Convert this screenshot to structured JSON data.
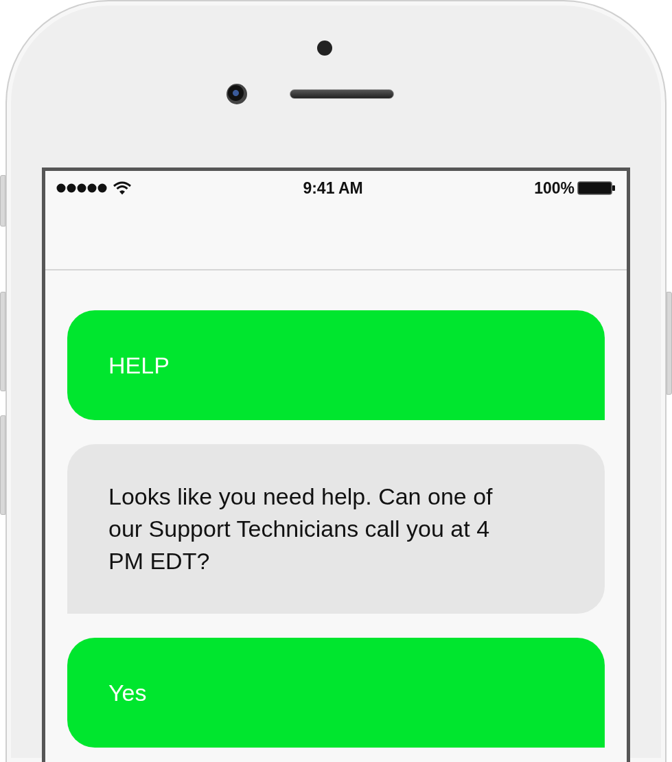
{
  "status_bar": {
    "time": "9:41 AM",
    "battery": "100%"
  },
  "messages": [
    {
      "kind": "sent",
      "text": "HELP"
    },
    {
      "kind": "received",
      "text": "Looks like you need help. Can one of our Support Technicians call you at 4 PM EDT?"
    },
    {
      "kind": "sent",
      "text": "Yes"
    }
  ]
}
